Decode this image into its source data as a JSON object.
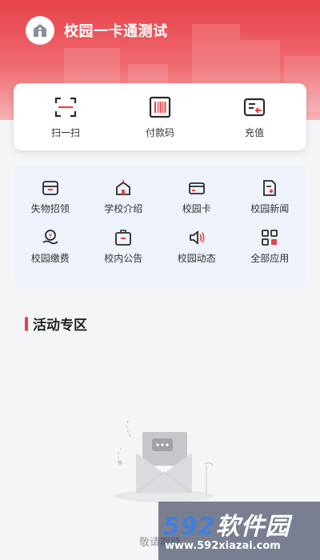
{
  "app": {
    "title": "校园一卡通测试"
  },
  "quick_actions": [
    {
      "label": "扫一扫",
      "icon": "scan-icon"
    },
    {
      "label": "付款码",
      "icon": "barcode-icon"
    },
    {
      "label": "充值",
      "icon": "recharge-icon"
    }
  ],
  "services": [
    {
      "label": "失物招领",
      "icon": "lost-found-icon"
    },
    {
      "label": "学校介绍",
      "icon": "school-icon"
    },
    {
      "label": "校园卡",
      "icon": "card-icon"
    },
    {
      "label": "校园新闻",
      "icon": "news-icon"
    },
    {
      "label": "校园缴费",
      "icon": "payment-icon"
    },
    {
      "label": "校内公告",
      "icon": "announcement-icon"
    },
    {
      "label": "校园动态",
      "icon": "speaker-icon"
    },
    {
      "label": "全部应用",
      "icon": "all-apps-icon"
    }
  ],
  "activity": {
    "title": "活动专区",
    "empty_text": "敬请期待"
  },
  "watermark": {
    "brand_num": "592",
    "brand_cn": "软件园",
    "url": "www.592xiazai.com"
  },
  "colors": {
    "accent": "#e8424a",
    "icon_dark": "#2b2b2b",
    "grid_bg": "#edf2fb"
  }
}
